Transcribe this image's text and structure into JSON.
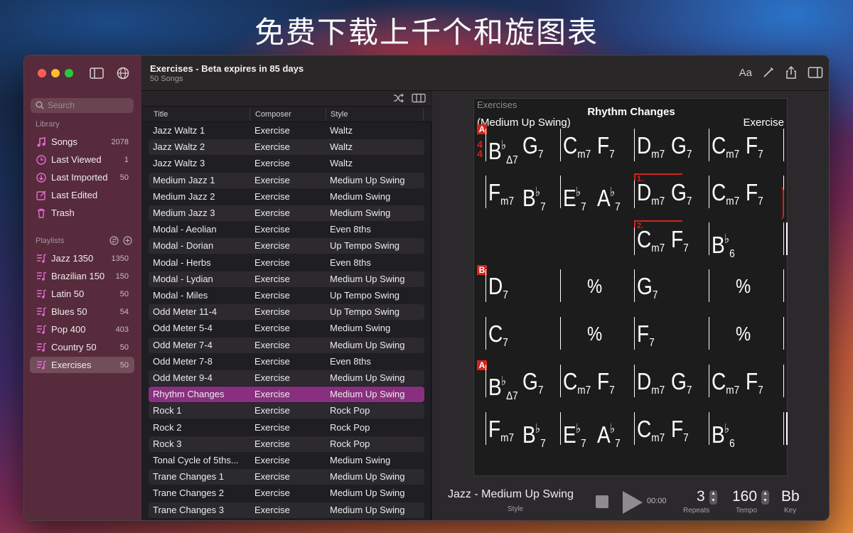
{
  "banner": {
    "text": "免费下载上千个和旋图表"
  },
  "colors": {
    "accent": "#8a2f7f",
    "rehearsal": "#d4241c",
    "close": "#ff5f57",
    "minimize": "#febc2e",
    "zoom": "#28c840"
  },
  "sidebar": {
    "search_placeholder": "Search",
    "library_label": "Library",
    "library": [
      {
        "label": "Songs",
        "count": "2078",
        "icon": "music-note-icon"
      },
      {
        "label": "Last Viewed",
        "count": "1",
        "icon": "clock-icon"
      },
      {
        "label": "Last Imported",
        "count": "50",
        "icon": "download-circle-icon"
      },
      {
        "label": "Last Edited",
        "count": "",
        "icon": "edit-icon"
      },
      {
        "label": "Trash",
        "count": "",
        "icon": "trash-icon"
      }
    ],
    "playlists_label": "Playlists",
    "playlists": [
      {
        "label": "Jazz 1350",
        "count": "1350"
      },
      {
        "label": "Brazilian 150",
        "count": "150"
      },
      {
        "label": "Latin 50",
        "count": "50"
      },
      {
        "label": "Blues 50",
        "count": "54"
      },
      {
        "label": "Pop 400",
        "count": "403"
      },
      {
        "label": "Country 50",
        "count": "50"
      },
      {
        "label": "Exercises",
        "count": "50",
        "selected": true
      }
    ]
  },
  "toolbar": {
    "title": "Exercises - Beta expires in 85 days",
    "subtitle": "50 Songs",
    "font_button": "Aa"
  },
  "list": {
    "columns": [
      "Title",
      "Composer",
      "Style"
    ],
    "rows": [
      [
        "Jazz Waltz 1",
        "Exercise",
        "Waltz"
      ],
      [
        "Jazz Waltz 2",
        "Exercise",
        "Waltz"
      ],
      [
        "Jazz Waltz 3",
        "Exercise",
        "Waltz"
      ],
      [
        "Medium Jazz 1",
        "Exercise",
        "Medium Up Swing"
      ],
      [
        "Medium Jazz 2",
        "Exercise",
        "Medium Swing"
      ],
      [
        "Medium Jazz 3",
        "Exercise",
        "Medium Swing"
      ],
      [
        "Modal - Aeolian",
        "Exercise",
        "Even 8ths"
      ],
      [
        "Modal - Dorian",
        "Exercise",
        "Up Tempo Swing"
      ],
      [
        "Modal - Herbs",
        "Exercise",
        "Even 8ths"
      ],
      [
        "Modal - Lydian",
        "Exercise",
        "Medium Up Swing"
      ],
      [
        "Modal - Miles",
        "Exercise",
        "Up Tempo Swing"
      ],
      [
        "Odd Meter 11-4",
        "Exercise",
        "Up Tempo Swing"
      ],
      [
        "Odd Meter 5-4",
        "Exercise",
        "Medium Swing"
      ],
      [
        "Odd Meter 7-4",
        "Exercise",
        "Medium Up Swing"
      ],
      [
        "Odd Meter 7-8",
        "Exercise",
        "Even 8ths"
      ],
      [
        "Odd Meter 9-4",
        "Exercise",
        "Medium Up Swing"
      ],
      [
        "Rhythm Changes",
        "Exercise",
        "Medium Up Swing"
      ],
      [
        "Rock 1",
        "Exercise",
        "Rock Pop"
      ],
      [
        "Rock 2",
        "Exercise",
        "Rock Pop"
      ],
      [
        "Rock 3",
        "Exercise",
        "Rock Pop"
      ],
      [
        "Tonal Cycle of 5ths...",
        "Exercise",
        "Medium Swing"
      ],
      [
        "Trane Changes 1",
        "Exercise",
        "Medium Up Swing"
      ],
      [
        "Trane Changes 2",
        "Exercise",
        "Medium Up Swing"
      ],
      [
        "Trane Changes 3",
        "Exercise",
        "Medium Up Swing"
      ]
    ],
    "selected_index": 16
  },
  "sheet": {
    "playlist": "Exercises",
    "title": "Rhythm Changes",
    "style": "(Medium Up Swing)",
    "composer": "Exercise",
    "time_signature": "4/4",
    "sections": [
      "A",
      "B",
      "A"
    ],
    "endings": [
      "1.",
      "2."
    ],
    "repeat_symbol": "%",
    "rows": [
      {
        "section": "A",
        "measures": [
          [
            "B♭Δ7",
            "G7"
          ],
          [
            "Cm7",
            "F7"
          ],
          [
            "Dm7",
            "G7"
          ],
          [
            "Cm7",
            "F7"
          ]
        ]
      },
      {
        "section": "",
        "measures": [
          [
            "Fm7",
            "B♭7"
          ],
          [
            "E♭7",
            "A♭7"
          ],
          [
            "Dm7",
            "G7"
          ],
          [
            "Cm7",
            "F7"
          ]
        ]
      },
      {
        "section": "",
        "measures": [
          [],
          [],
          [
            "Cm7",
            "F7"
          ],
          [
            "B♭6"
          ]
        ]
      },
      {
        "section": "B",
        "measures": [
          [
            "D7"
          ],
          [
            "%"
          ],
          [
            "G7"
          ],
          [
            "%"
          ]
        ]
      },
      {
        "section": "",
        "measures": [
          [
            "C7"
          ],
          [
            "%"
          ],
          [
            "F7"
          ],
          [
            "%"
          ]
        ]
      },
      {
        "section": "A",
        "measures": [
          [
            "B♭Δ7",
            "G7"
          ],
          [
            "Cm7",
            "F7"
          ],
          [
            "Dm7",
            "G7"
          ],
          [
            "Cm7",
            "F7"
          ]
        ]
      },
      {
        "section": "",
        "measures": [
          [
            "Fm7",
            "B♭7"
          ],
          [
            "E♭7",
            "A♭7"
          ],
          [
            "Cm7",
            "F7"
          ],
          [
            "B♭6"
          ]
        ]
      }
    ]
  },
  "transport": {
    "style": "Jazz - Medium Up Swing",
    "style_label": "Style",
    "time": "00:00",
    "repeats": "3",
    "repeats_label": "Repeats",
    "tempo": "160",
    "tempo_label": "Tempo",
    "key": "Bb",
    "key_label": "Key"
  }
}
